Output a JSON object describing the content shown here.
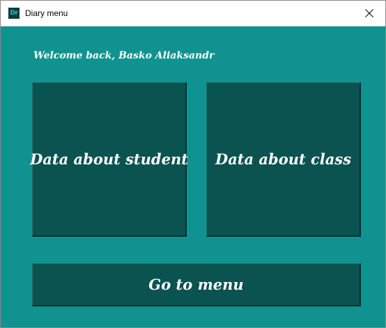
{
  "window": {
    "title": "Diary menu",
    "icon_text": "Dr",
    "icon_name": "app-icon",
    "close_icon": "close-icon",
    "background_color": "#109390",
    "tile_color": "#0a5350"
  },
  "main": {
    "welcome_text": "Welcome back, Basko Aliaksandr",
    "student_button_label": "Data about student",
    "class_button_label": "Data about class",
    "menu_button_label": "Go to menu"
  }
}
